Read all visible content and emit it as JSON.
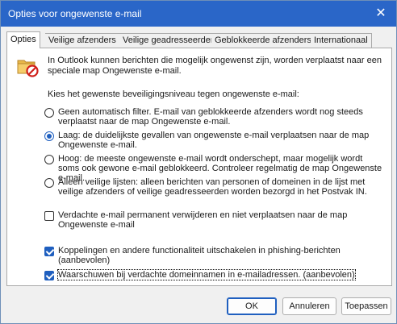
{
  "window": {
    "title": "Opties voor ongewenste e-mail"
  },
  "tabs": [
    {
      "label": "Opties"
    },
    {
      "label": "Veilige afzenders"
    },
    {
      "label": "Veilige geadresseerden"
    },
    {
      "label": "Geblokkeerde afzenders"
    },
    {
      "label": "Internationaal"
    }
  ],
  "intro": {
    "text": "In Outlook kunnen berichten die mogelijk ongewenst zijn, worden verplaatst naar een speciale map Ongewenste e-mail."
  },
  "levels": {
    "label": "Kies het gewenste beveiligingsniveau tegen ongewenste e-mail:",
    "options": [
      {
        "text": "Geen automatisch filter. E-mail van geblokkeerde afzenders wordt nog steeds verplaatst naar de map Ongewenste e-mail.",
        "selected": false
      },
      {
        "text": "Laag: de duidelijkste gevallen van ongewenste e-mail verplaatsen naar de map Ongewenste e-mail.",
        "selected": true
      },
      {
        "text": "Hoog: de meeste ongewenste e-mail wordt onderschept, maar mogelijk wordt soms ook gewone e-mail geblokkeerd. Controleer regelmatig de map Ongewenste e-mail.",
        "selected": false
      },
      {
        "text": "Alleen veilige lijsten: alleen berichten van personen of domeinen in de lijst met veilige afzenders of veilige geadresseerden worden bezorgd in het Postvak IN.",
        "selected": false
      }
    ]
  },
  "checkboxes": [
    {
      "text": "Verdachte e-mail permanent verwijderen en niet verplaatsen naar de map Ongewenste e-mail",
      "checked": false
    },
    {
      "text": "Koppelingen en andere functionaliteit uitschakelen in phishing-berichten (aanbevolen)",
      "checked": true
    },
    {
      "text": "Waarschuwen bij verdachte domeinnamen in e-mailadressen. (aanbevolen)",
      "checked": true
    }
  ],
  "buttons": {
    "ok": "OK",
    "cancel": "Annuleren",
    "apply": "Toepassen"
  },
  "icons": {
    "close": "close-icon",
    "junk": "junk-folder-icon"
  },
  "colors": {
    "titlebar": "#2a66c8",
    "accent": "#1f5fbf"
  }
}
